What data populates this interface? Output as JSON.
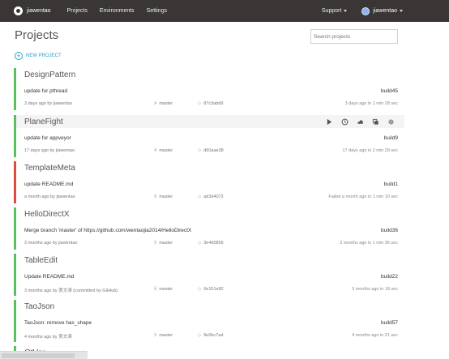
{
  "topbar": {
    "brand": "jiawentao",
    "nav": [
      "Projects",
      "Environments",
      "Settings"
    ],
    "support": "Support",
    "user": "jiawentao"
  },
  "page": {
    "title": "Projects",
    "search_placeholder": "Search projects",
    "new_project": "NEW PROJECT"
  },
  "projects": [
    {
      "name": "DesignPattern",
      "status": "success",
      "message": "update for pthread",
      "build": "build45",
      "meta": "3 days ago by jiawentao",
      "branch": "master",
      "commit": "87c3abd9",
      "result": "3 days ago in 1 min 28 sec"
    },
    {
      "name": "PlaneFight",
      "status": "success",
      "message": "update for appveyor",
      "build": "build9",
      "meta": "17 days ago by jiawentao",
      "branch": "master",
      "commit": "d60aae38",
      "result": "17 days ago in 2 min 29 sec"
    },
    {
      "name": "TemplateMeta",
      "status": "failed",
      "message": "update README.md",
      "build": "build1",
      "meta": "a month ago by jiawentao",
      "branch": "master",
      "commit": "ad3d4072",
      "result": "Failed a month ago in 1 min 10 sec"
    },
    {
      "name": "HelloDirectX",
      "status": "success",
      "message": "Merge branch 'master' of https://github.com/wentaojia2014/HelloDirectX",
      "build": "build36",
      "meta": "3 months ago by jiawentao",
      "branch": "master",
      "commit": "3e4d0856",
      "result": "3 months ago in 1 min 36 sec"
    },
    {
      "name": "TableEdit",
      "status": "success",
      "message": "Update README.md",
      "build": "build22",
      "meta": "3 months ago by 贾文涛 (committed by GitHub)",
      "branch": "master",
      "commit": "0e151e82",
      "result": "3 months ago in 18 sec"
    },
    {
      "name": "TaoJson",
      "status": "success",
      "message": "TaoJson: remove has_shape",
      "build": "build57",
      "meta": "4 months ago by 贾文涛",
      "branch": "master",
      "commit": "9e0bc7ad",
      "result": "4 months ago in 21 sec"
    },
    {
      "name": "QtVer",
      "status": "success"
    }
  ],
  "colors": {
    "success": "#5cbf5c",
    "failed": "#e04c3c",
    "accent": "#2f9fd0",
    "topbar": "#3a3636"
  },
  "icons": {
    "branch": "branch-icon",
    "commit": "commit-icon",
    "actions": [
      "play-icon",
      "history-icon",
      "deploy-icon",
      "badge-icon",
      "gear-icon"
    ]
  }
}
